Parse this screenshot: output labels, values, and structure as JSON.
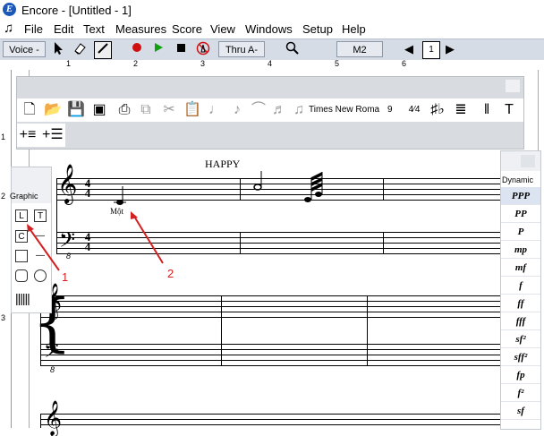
{
  "window": {
    "title": "Encore - [Untitled - 1]",
    "app_icon_letter": "E"
  },
  "menu": {
    "items": [
      "File",
      "Edit",
      "Text",
      "Measures",
      "Score",
      "View",
      "Windows",
      "Setup",
      "Help"
    ]
  },
  "toolbar": {
    "voice_label": "Voice -",
    "thru_label": "Thru A-",
    "measure_label": "M2",
    "page_number": "1"
  },
  "ruler": {
    "top_numbers": [
      "1",
      "2",
      "3",
      "4",
      "5",
      "6"
    ],
    "left_numbers": [
      "1",
      "2",
      "3"
    ]
  },
  "note_palette": {
    "font_name": "Times New Roma",
    "font_size": "9"
  },
  "score": {
    "title": "HAPPY",
    "lyric": "Một"
  },
  "graphic_palette": {
    "label": "Graphic",
    "tools": [
      "L",
      "T",
      "C"
    ]
  },
  "dynamics_palette": {
    "label": "Dynamic",
    "items": [
      "PPP",
      "PP",
      "P",
      "mp",
      "mf",
      "f",
      "ff",
      "fff",
      "sf²",
      "sff²",
      "fp",
      "f²",
      "sf"
    ]
  },
  "annotations": {
    "one": "1",
    "two": "2"
  },
  "colors": {
    "toolbar_bg": "#d6dce6",
    "accent_blue": "#1c58b8",
    "annotation_red": "#d42020",
    "record_red": "#d01010",
    "play_green": "#10a010"
  }
}
